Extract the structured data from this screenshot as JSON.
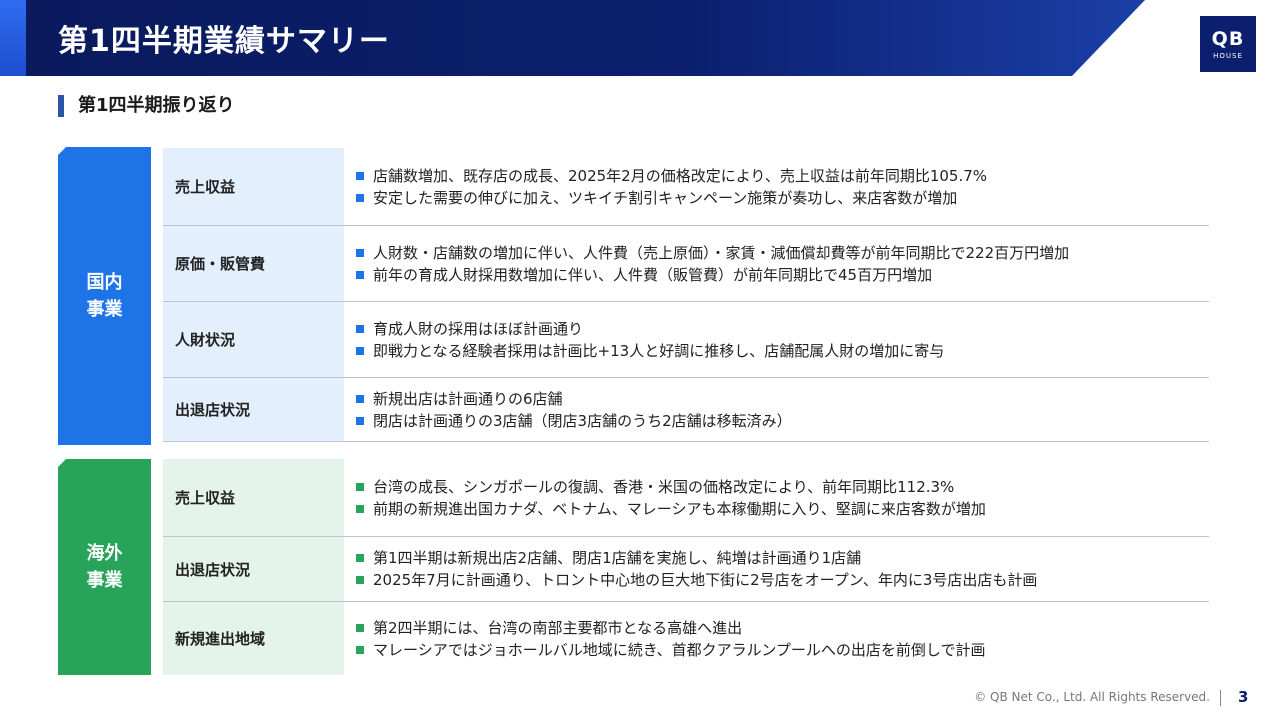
{
  "header": {
    "title": "第1四半期業績サマリー",
    "logo_main": "QB",
    "logo_sub": "HOUSE"
  },
  "section": {
    "title": "第1四半期振り返り"
  },
  "domestic": {
    "tab": [
      "国内",
      "事業"
    ],
    "rows": [
      {
        "label": "売上収益",
        "items": [
          "店舗数増加、既存店の成長、2025年2月の価格改定により、売上収益は前年同期比105.7%",
          "安定した需要の伸びに加え、ツキイチ割引キャンペーン施策が奏功し、来店客数が増加"
        ]
      },
      {
        "label": "原価・販管費",
        "items": [
          "人財数・店舗数の増加に伴い、人件費（売上原価）・家賃・減価償却費等が前年同期比で222百万円増加",
          "前年の育成人財採用数増加に伴い、人件費（販管費）が前年同期比で45百万円増加"
        ]
      },
      {
        "label": "人財状況",
        "items": [
          "育成人財の採用はほぼ計画通り",
          "即戦力となる経験者採用は計画比+13人と好調に推移し、店舗配属人財の増加に寄与"
        ]
      },
      {
        "label": "出退店状況",
        "items": [
          "新規出店は計画通りの6店舗",
          "閉店は計画通りの3店舗（閉店3店舗のうち2店舗は移転済み）"
        ]
      }
    ]
  },
  "overseas": {
    "tab": [
      "海外",
      "事業"
    ],
    "rows": [
      {
        "label": "売上収益",
        "items": [
          "台湾の成長、シンガポールの復調、香港・米国の価格改定により、前年同期比112.3%",
          "前期の新規進出国カナダ、ベトナム、マレーシアも本稼働期に入り、堅調に来店客数が増加"
        ]
      },
      {
        "label": "出退店状況",
        "items": [
          "第1四半期は新規出店2店舗、閉店1店舗を実施し、純増は計画通り1店舗",
          "2025年7月に計画通り、トロント中心地の巨大地下街に2号店をオープン、年内に3号店出店も計画"
        ]
      },
      {
        "label": "新規進出地域",
        "items": [
          "第2四半期には、台湾の南部主要都市となる高雄へ進出",
          "マレーシアではジョホールバル地域に続き、首都クアラルンプールへの出店を前倒しで計画"
        ]
      }
    ]
  },
  "footer": {
    "copyright": "© QB Net Co., Ltd. All Rights Reserved.",
    "page": "3"
  },
  "colors": {
    "navy": "#0b1f6e",
    "domestic": "#1e74e6",
    "overseas": "#27a35a"
  }
}
